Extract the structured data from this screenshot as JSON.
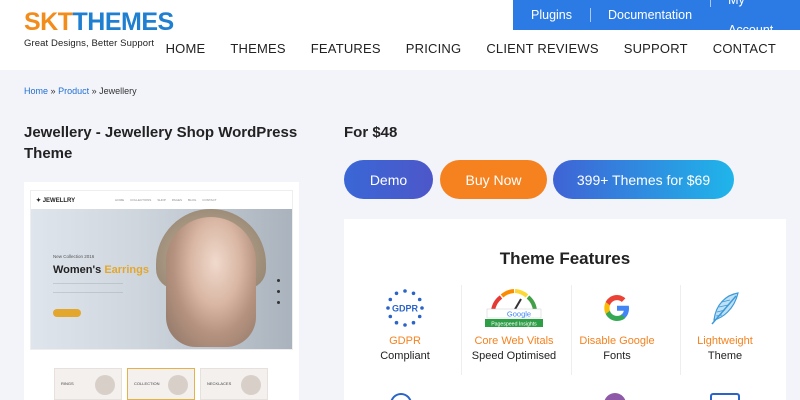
{
  "brand": {
    "logo_skt": "SKT",
    "logo_themes": "THEMES",
    "tagline": "Great Designs, Better Support",
    "accent": "#f28c1b",
    "primary": "#1f7fd1"
  },
  "topbar": {
    "links": [
      "Plugins",
      "Documentation",
      "My Account"
    ],
    "bg": "#2c7be5"
  },
  "nav": {
    "items": [
      "HOME",
      "THEMES",
      "FEATURES",
      "PRICING",
      "CLIENT REVIEWS",
      "SUPPORT",
      "CONTACT"
    ]
  },
  "breadcrumb": {
    "home": "Home",
    "sep": "»",
    "product": "Product",
    "current": "Jewellery"
  },
  "product": {
    "title": "Jewellery - Jewellery Shop WordPress Theme",
    "price": "For $48"
  },
  "buttons": {
    "demo": "Demo",
    "buy": "Buy Now",
    "bundle": "399+ Themes for $69"
  },
  "preview": {
    "logo": "✦ JEWELLRY",
    "nav_links": [
      "HOME",
      "COLLECTIONS",
      "SHOP",
      "PAGES",
      "BLOG",
      "CONTACT"
    ],
    "kicker": "New Collection 2016",
    "headline_main": "Women's ",
    "headline_accent": "Earrings",
    "thumbs": [
      "RINGS",
      "COLLECTION",
      "NECKLACES"
    ]
  },
  "features": {
    "title": "Theme Features",
    "items": [
      {
        "title": "GDPR",
        "subtitle": "Compliant",
        "icon": "gdpr-icon"
      },
      {
        "title": "Core Web Vitals",
        "subtitle": "Speed Optimised",
        "icon": "pagespeed-icon"
      },
      {
        "title": "Disable Google",
        "subtitle": "Fonts",
        "icon": "google-icon"
      },
      {
        "title": "Lightweight",
        "subtitle": "Theme",
        "icon": "feather-icon"
      }
    ],
    "gdpr_badge": "GDPR",
    "pagespeed_google": "Google",
    "pagespeed_label": "Pagespeed Insights"
  }
}
